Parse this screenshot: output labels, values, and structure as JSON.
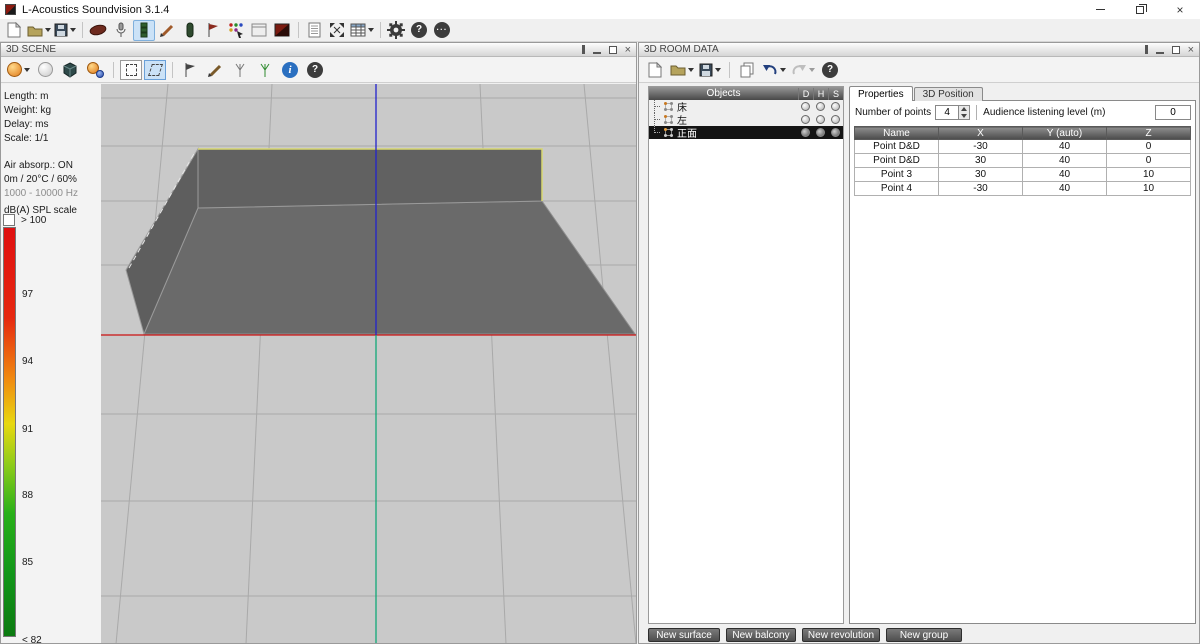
{
  "window": {
    "title": "L-Acoustics Soundvision 3.1.4"
  },
  "scene_panel": {
    "title": "3D SCENE",
    "info": {
      "length": "Length: m",
      "weight": "Weight: kg",
      "delay": "Delay: ms",
      "scale": "Scale: 1/1",
      "air_absorption": "Air absorp.: ON",
      "environment": "0m / 20°C / 60%",
      "frequency_range": "1000 - 10000 Hz"
    },
    "spl_scale": {
      "label": "dB(A) SPL scale",
      "max": "> 100",
      "ticks": [
        "97",
        "94",
        "91",
        "88",
        "85"
      ],
      "min": "< 82"
    }
  },
  "room_panel": {
    "title": "3D ROOM DATA",
    "objects": {
      "header": "Objects",
      "columns": [
        "D",
        "H",
        "S"
      ],
      "items": [
        {
          "label": "床",
          "selected": false
        },
        {
          "label": "左",
          "selected": false
        },
        {
          "label": "正面",
          "selected": true
        }
      ]
    },
    "tabs": {
      "properties": "Properties",
      "position": "3D Position"
    },
    "properties": {
      "number_of_points_label": "Number of points",
      "number_of_points_value": "4",
      "audience_level_label": "Audience listening level (m)",
      "audience_level_value": "0",
      "table": {
        "headers": [
          "Name",
          "X",
          "Y (auto)",
          "Z"
        ],
        "rows": [
          [
            "Point D&D",
            "-30",
            "40",
            "0"
          ],
          [
            "Point D&D",
            "30",
            "40",
            "0"
          ],
          [
            "Point 3",
            "30",
            "40",
            "10"
          ],
          [
            "Point 4",
            "-30",
            "40",
            "10"
          ]
        ]
      }
    },
    "footer_buttons": [
      "New surface",
      "New balcony",
      "New revolution",
      "New group"
    ]
  },
  "icons": {
    "new-document-icon": "page shape",
    "open-folder-icon": "folder shape",
    "save-icon": "floppy shape",
    "gear-icon": "gear shape",
    "help-icon": "?",
    "more-icon": "···",
    "undo-icon": "curved-left-arrow",
    "redo-icon": "curved-right-arrow",
    "info-icon": "i"
  },
  "colors": {
    "selection": "#cbe2f7",
    "header_gradient_top": "#969696",
    "header_gradient_bottom": "#484848",
    "axis_x_red": "#cc1111",
    "axis_z_blue": "#2222cc",
    "axis_y_green": "#11a877",
    "selected_surface_outline": "#d8d870",
    "viewport_background": "#c9c9c9"
  }
}
